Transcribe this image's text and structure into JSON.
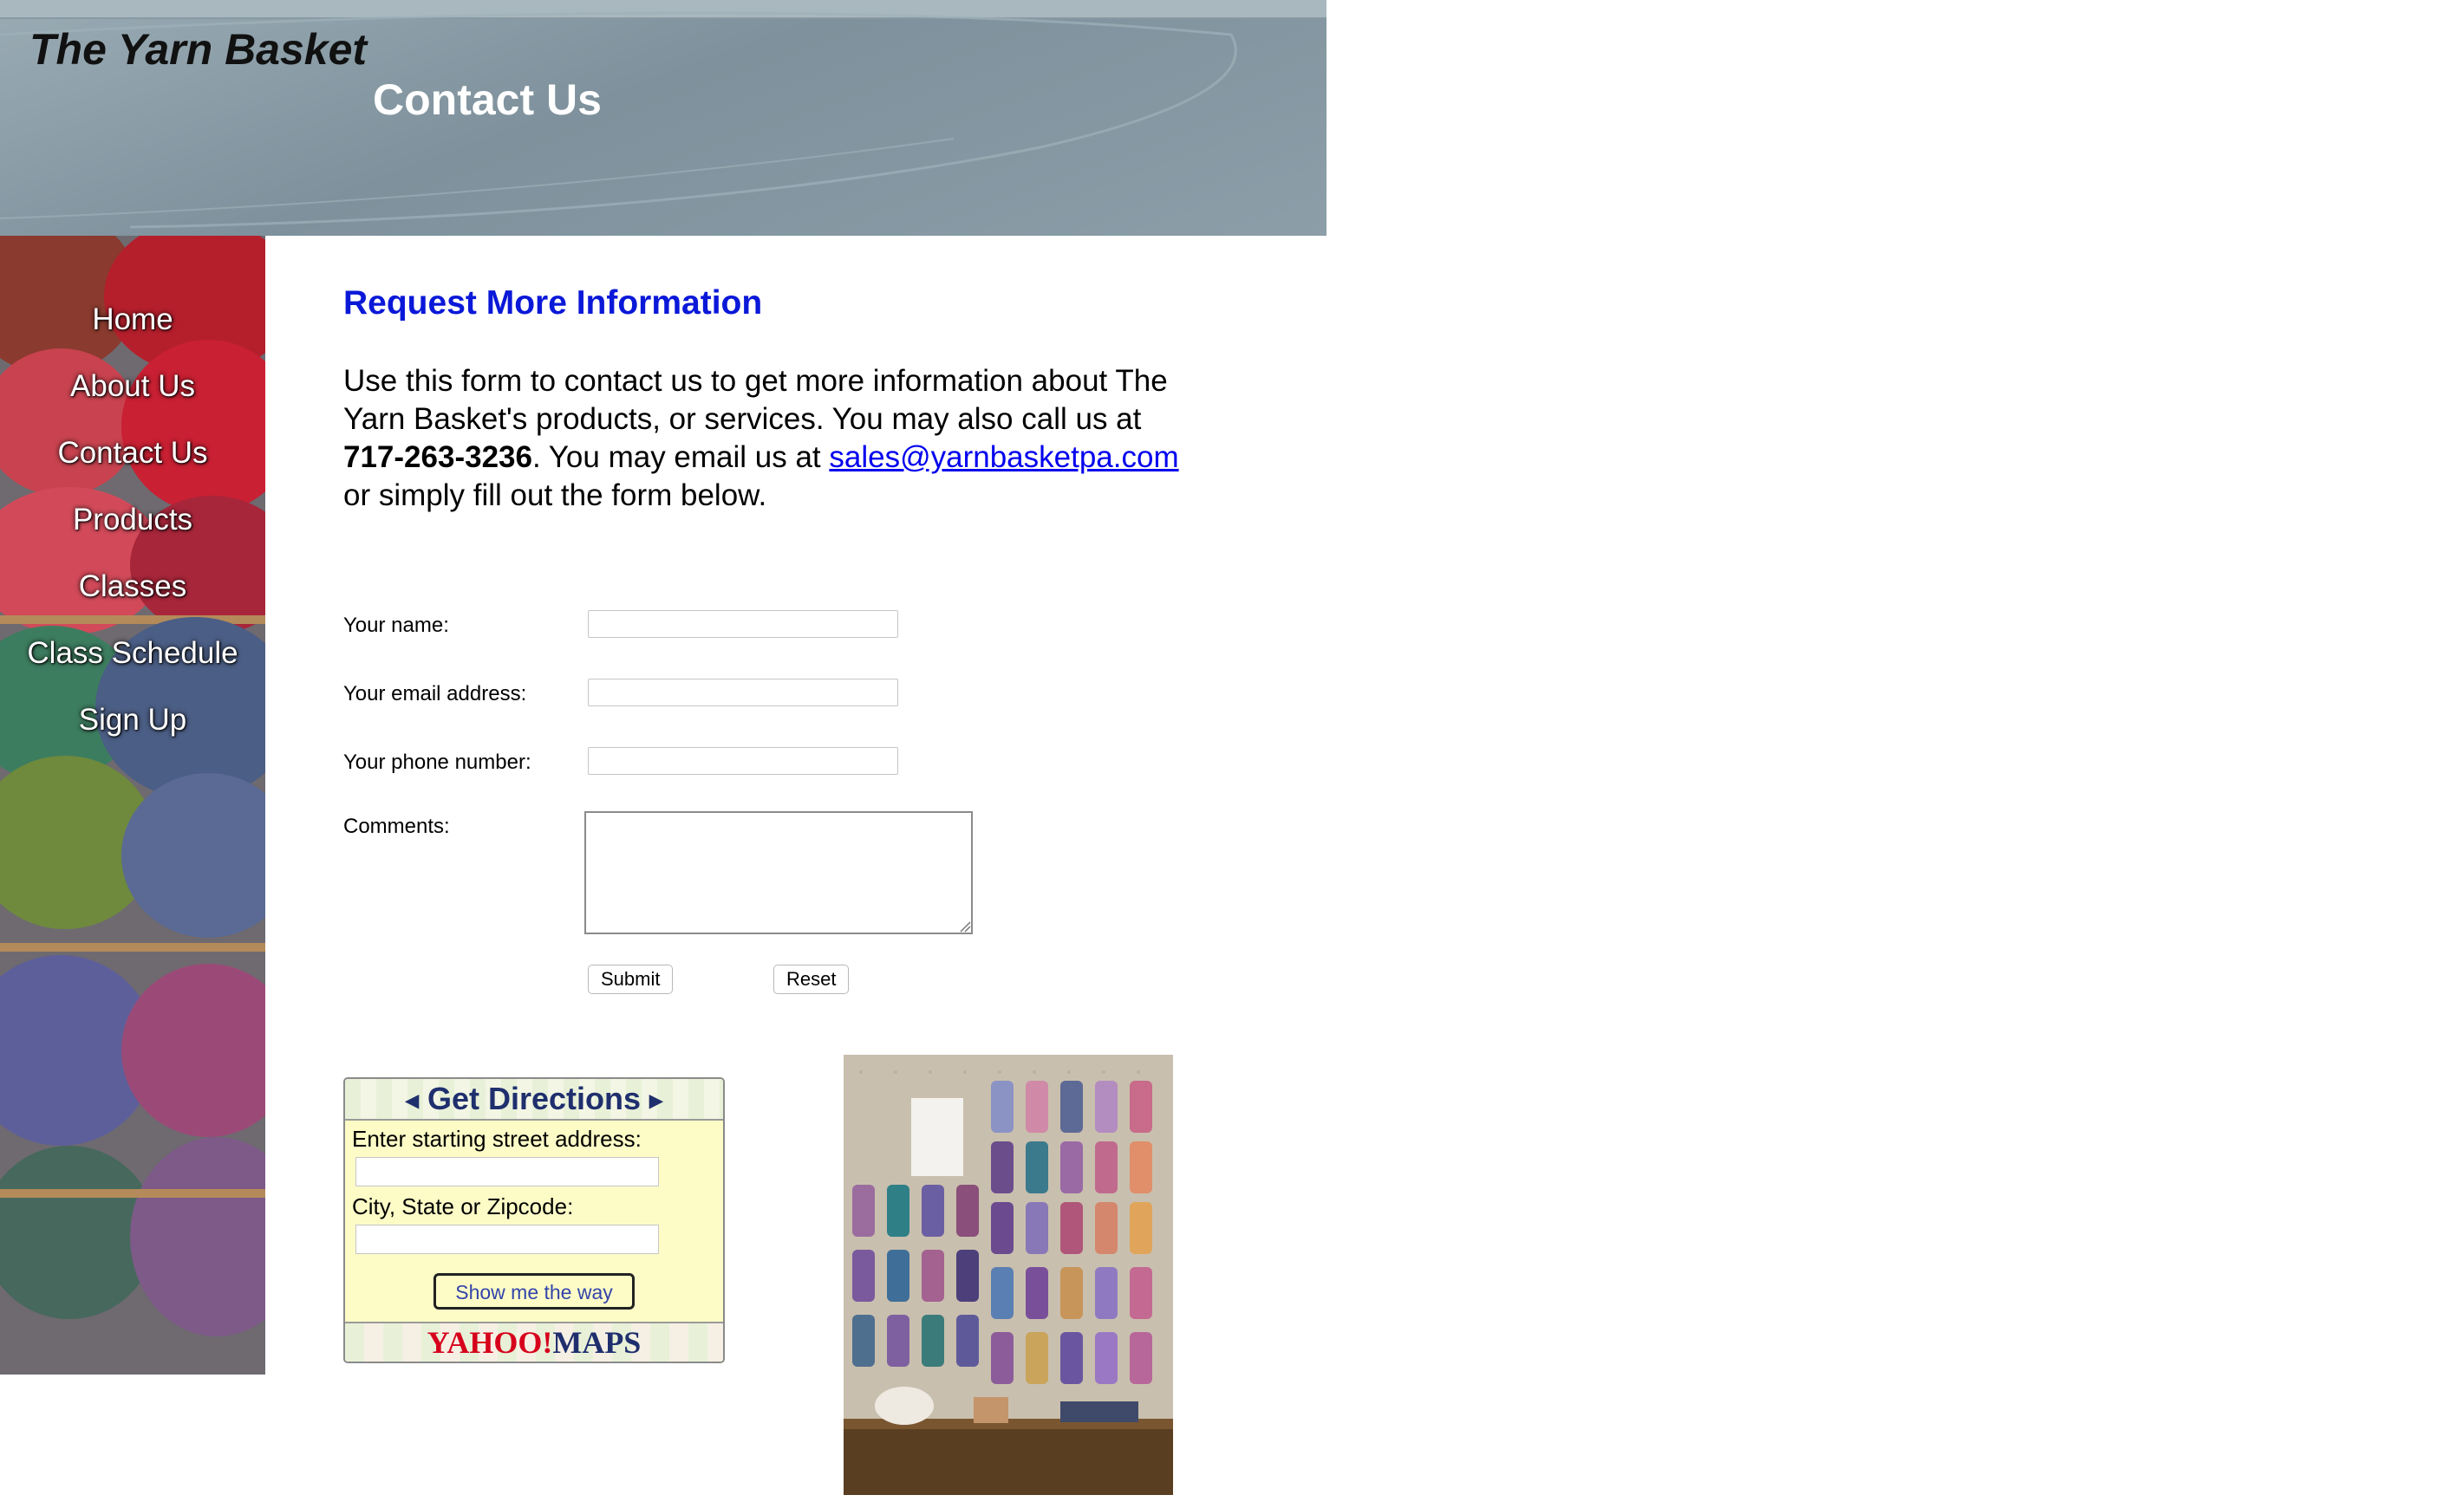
{
  "header": {
    "site_title": "The Yarn Basket",
    "page_heading": "Contact Us"
  },
  "nav": {
    "items": [
      {
        "label": "Home"
      },
      {
        "label": "About Us"
      },
      {
        "label": "Contact Us"
      },
      {
        "label": "Products"
      },
      {
        "label": "Classes"
      },
      {
        "label": "Class Schedule"
      },
      {
        "label": "Sign Up"
      }
    ]
  },
  "main": {
    "title": "Request More Information",
    "intro_part1": "Use this form to contact us to get more information about The Yarn Basket's products, or services.  You may also call us at ",
    "phone": "717-263-3236",
    "intro_part2": ". You may email us at ",
    "email": "sales@yarnbasketpa.com",
    "intro_part3": " or simply fill out the form below."
  },
  "form": {
    "name_label": "Your name:",
    "name_value": "",
    "email_label": "Your email address:",
    "email_value": "",
    "phone_label": "Your phone number:",
    "phone_value": "",
    "comments_label": "Comments:",
    "comments_value": "",
    "submit_label": "Submit",
    "reset_label": "Reset"
  },
  "directions": {
    "title": "Get Directions",
    "start_label": "Enter starting street address:",
    "start_value": "",
    "city_label": "City, State or Zipcode:",
    "city_value": "",
    "button_label": "Show me the way",
    "brand_yahoo": "YAHOO!",
    "brand_maps": "MAPS"
  },
  "colors": {
    "heading_blue": "#0a18d8",
    "link_blue": "#0000ee",
    "widget_yellow": "#fdfcc7",
    "header_steel": "#8c9ea8"
  },
  "icons": {
    "prev_arrow": "left-triangle-icon",
    "next_arrow": "right-triangle-icon",
    "resize": "resize-grip-icon"
  }
}
